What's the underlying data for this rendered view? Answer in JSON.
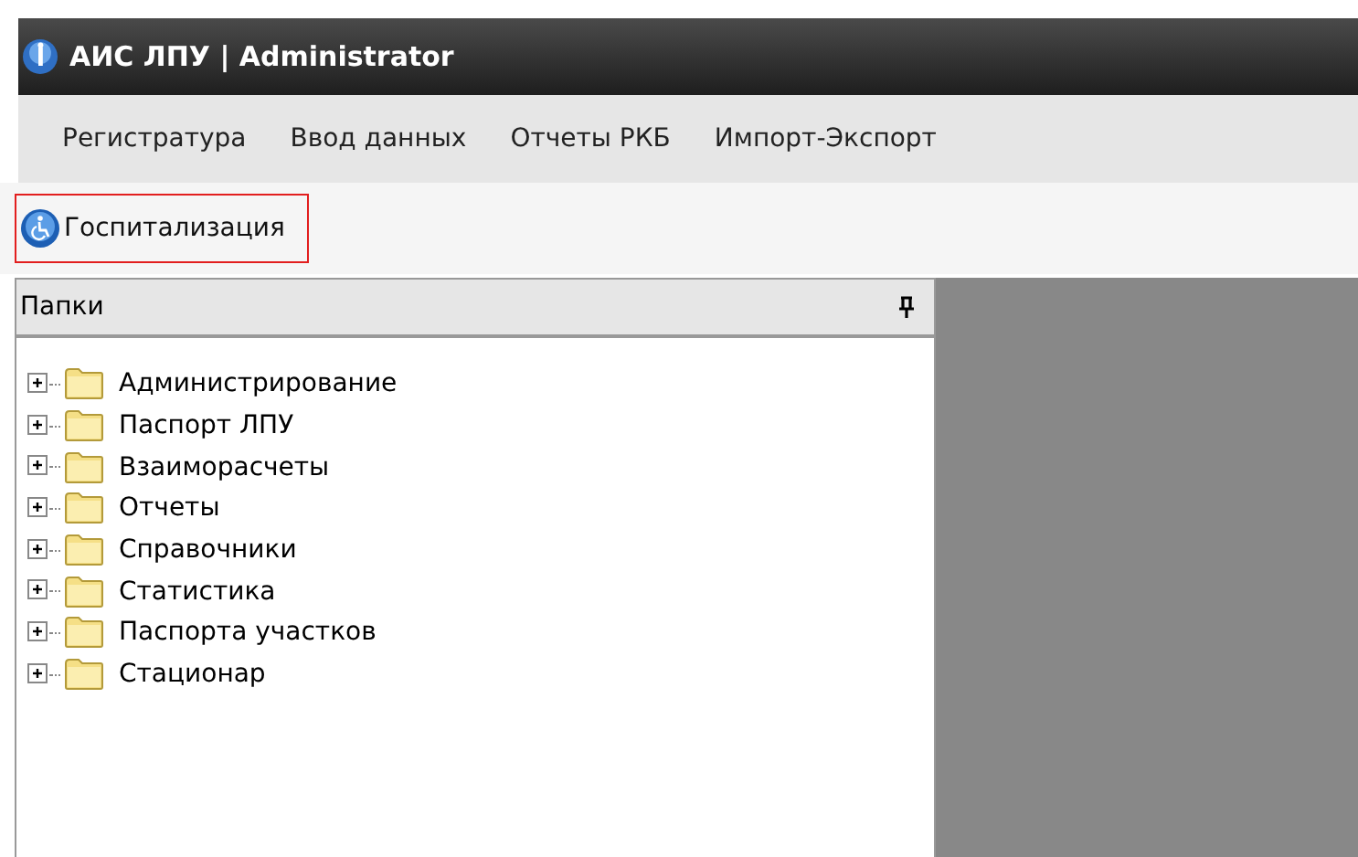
{
  "window": {
    "title": "АИС ЛПУ | Administrator"
  },
  "menu": [
    "Регистратура",
    "Ввод данных",
    "Отчеты РКБ",
    "Импорт-Экспорт"
  ],
  "toolbar": [
    {
      "label": "Госпитализация",
      "selected": true
    }
  ],
  "folders_panel": {
    "title": "Папки",
    "items": [
      {
        "label": "Администрирование",
        "expanded": false
      },
      {
        "label": "Паспорт ЛПУ",
        "expanded": false
      },
      {
        "label": "Взаиморасчеты",
        "expanded": false
      },
      {
        "label": "Отчеты",
        "expanded": false
      },
      {
        "label": "Справочники",
        "expanded": false
      },
      {
        "label": "Статистика",
        "expanded": false
      },
      {
        "label": "Паспорта участков",
        "expanded": false
      },
      {
        "label": "Стационар",
        "expanded": false
      }
    ]
  }
}
